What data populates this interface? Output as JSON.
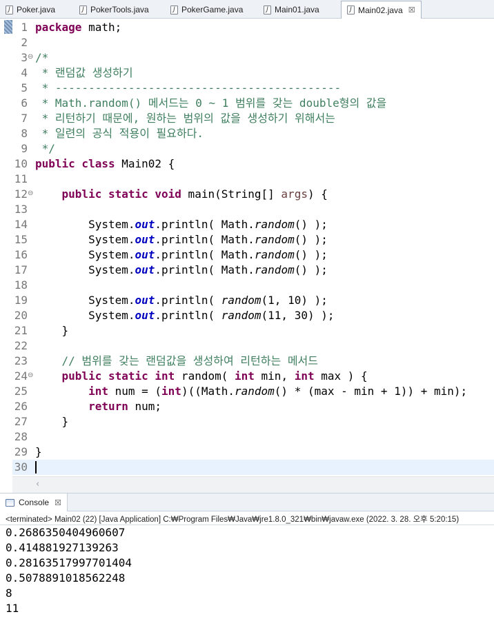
{
  "tabs": [
    {
      "label": "Poker.java",
      "icon": "java-file-icon",
      "active": false
    },
    {
      "label": "PokerTools.java",
      "icon": "java-file-icon",
      "active": false
    },
    {
      "label": "PokerGame.java",
      "icon": "java-file-icon",
      "active": false
    },
    {
      "label": "Main01.java",
      "icon": "java-file-icon",
      "active": false
    },
    {
      "label": "Main02.java",
      "icon": "java-file-icon",
      "active": true
    }
  ],
  "editor": {
    "line_numbers": [
      "1",
      "2",
      "3",
      "4",
      "5",
      "6",
      "7",
      "8",
      "9",
      "10",
      "11",
      "12",
      "13",
      "14",
      "15",
      "16",
      "17",
      "18",
      "19",
      "20",
      "21",
      "22",
      "23",
      "24",
      "25",
      "26",
      "27",
      "28",
      "29",
      "30"
    ],
    "fold_markers": {
      "3": "⊖",
      "12": "⊖",
      "24": "⊖"
    },
    "current_line": "30",
    "code": {
      "l1_a": "package",
      "l1_b": " math;",
      "l3": "/*",
      "l4": " * 랜덤값 생성하기",
      "l5": " * -------------------------------------------",
      "l6": " * Math.random() 메서드는 0 ~ 1 범위를 갖는 double형의 값을",
      "l7": " * 리턴하기 때문에, 원하는 범위의 값을 생성하기 위해서는",
      "l8": " * 일련의 공식 적용이 필요하다.",
      "l9": " */",
      "l10_a": "public class",
      "l10_b": " Main02 {",
      "l12_a": "    public static void",
      "l12_b": " main(String[] ",
      "l12_c": "args",
      "l12_d": ") {",
      "sys": "        System.",
      "out": "out",
      "println": ".println( ",
      "math": "Math.",
      "random": "random",
      "rnd_end": "() );",
      "l19_args": "(1, 10) );",
      "l20_args": "(11, 30) );",
      "l21": "    }",
      "l23": "    // 범위를 갖는 랜덤값을 생성하여 리턴하는 메서드",
      "l24_a": "    public static int",
      "l24_b": " random( ",
      "l24_c": "int",
      "l24_d": " min, ",
      "l24_e": "int",
      "l24_f": " max ) {",
      "l25_a": "        int",
      "l25_b": " num = (",
      "l25_c": "int",
      "l25_d": ")((Math.",
      "l25_e": "random",
      "l25_f": "() * (max - min + 1)) + min);",
      "l26_a": "        return",
      "l26_b": " num;",
      "l27": "    }",
      "l29": "}"
    }
  },
  "console": {
    "tab_label": "Console",
    "status": "<terminated> Main02 (22) [Java Application] C:₩Program Files₩Java₩jre1.8.0_321₩bin₩javaw.exe (2022. 3. 28. 오후 5:20:15)",
    "output": [
      "0.2686350404960607",
      "0.414881927139263",
      "0.28163517997701404",
      "0.5078891018562248",
      "8",
      "11"
    ]
  },
  "close_glyph": "☒"
}
